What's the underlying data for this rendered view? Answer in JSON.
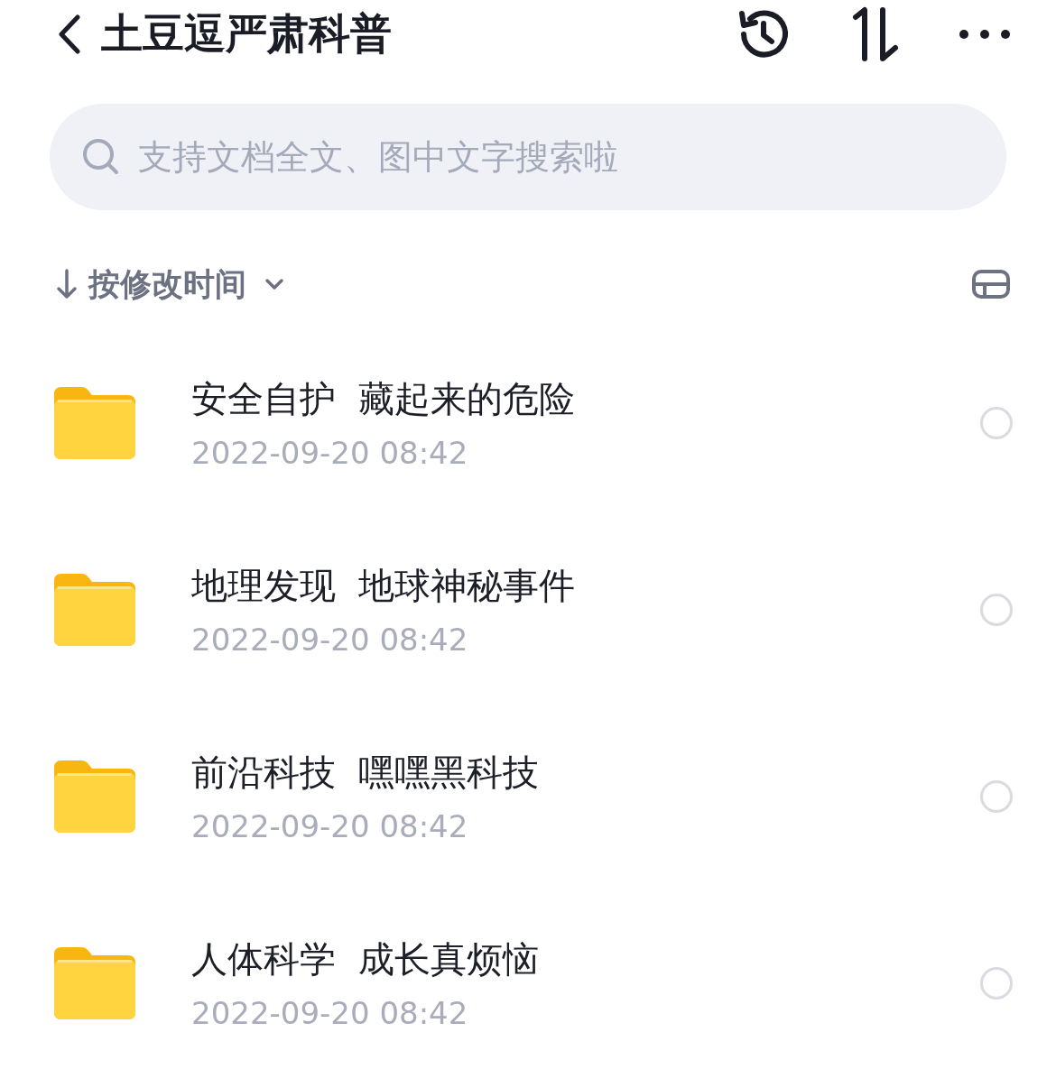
{
  "header": {
    "title": "土豆逗严肃科普"
  },
  "search": {
    "placeholder": "支持文档全文、图中文字搜索啦"
  },
  "sort": {
    "label": "按修改时间"
  },
  "items": [
    {
      "name": "安全自护  藏起来的危险",
      "date": "2022-09-20 08:42",
      "selected": false
    },
    {
      "name": "地理发现  地球神秘事件",
      "date": "2022-09-20 08:42",
      "selected": false
    },
    {
      "name": "前沿科技  嘿嘿黑科技",
      "date": "2022-09-20 08:42",
      "selected": false
    },
    {
      "name": "人体科学  成长真烦恼",
      "date": "2022-09-20 08:42",
      "selected": false
    }
  ]
}
